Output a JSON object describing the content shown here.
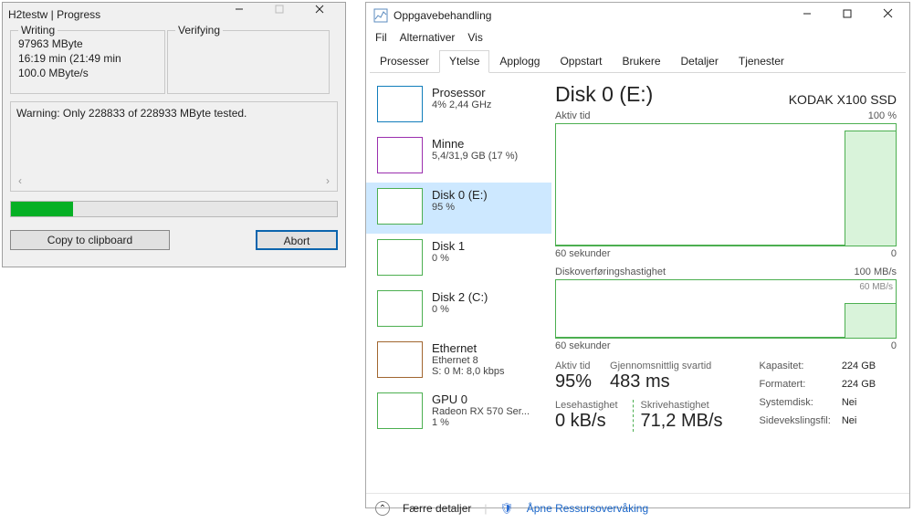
{
  "h2": {
    "title": "H2testw | Progress",
    "writing_legend": "Writing",
    "verifying_legend": "Verifying",
    "writing_l1": "97963 MByte",
    "writing_l2": "16:19 min (21:49 min",
    "writing_l3": "100.0 MByte/s",
    "warning": "Warning: Only 228833 of 228933 MByte tested.",
    "copy_btn": "Copy to clipboard",
    "abort_btn": "Abort",
    "progress_pct": 19
  },
  "tm": {
    "title": "Oppgavebehandling",
    "menu": [
      "Fil",
      "Alternativer",
      "Vis"
    ],
    "tabs": [
      "Prosesser",
      "Ytelse",
      "Applogg",
      "Oppstart",
      "Brukere",
      "Detaljer",
      "Tjenester"
    ],
    "active_tab": 1,
    "sidebar": [
      {
        "title": "Prosessor",
        "sub": "4%  2,44 GHz",
        "kind": "cpu"
      },
      {
        "title": "Minne",
        "sub": "5,4/31,9 GB (17 %)",
        "kind": "mem"
      },
      {
        "title": "Disk 0 (E:)",
        "sub": "95 %",
        "kind": "disk",
        "selected": true
      },
      {
        "title": "Disk 1",
        "sub": "0 %",
        "kind": "disk"
      },
      {
        "title": "Disk 2 (C:)",
        "sub": "0 %",
        "kind": "disk"
      },
      {
        "title": "Ethernet",
        "sub": "Ethernet 8",
        "sub2": "S: 0  M: 8,0 kbps",
        "kind": "eth"
      },
      {
        "title": "GPU 0",
        "sub": "Radeon RX 570 Ser...",
        "sub2": "1 %",
        "kind": "gpu"
      }
    ],
    "main": {
      "heading": "Disk 0 (E:)",
      "model": "KODAK X100 SSD",
      "chart1_tl": "Aktiv tid",
      "chart1_tr": "100 %",
      "chart1_bl": "60 sekunder",
      "chart1_br": "0",
      "chart2_t": "Diskoverføringshastighet",
      "chart2_tr": "100 MB/s",
      "chart2_rlbl": "60 MB/s",
      "chart2_bl": "60 sekunder",
      "chart2_br": "0",
      "s_active_lbl": "Aktiv tid",
      "s_active_val": "95%",
      "s_resp_lbl": "Gjennomsnittlig svartid",
      "s_resp_val": "483 ms",
      "s_read_lbl": "Lesehastighet",
      "s_read_val": "0 kB/s",
      "s_write_lbl": "Skrivehastighet",
      "s_write_val": "71,2 MB/s",
      "cap": {
        "k1": "Kapasitet:",
        "v1": "224 GB",
        "k2": "Formatert:",
        "v2": "224 GB",
        "k3": "Systemdisk:",
        "v3": "Nei",
        "k4": "Sidevekslingsfil:",
        "v4": "Nei"
      }
    },
    "footer": {
      "fewer": "Færre detaljer",
      "resmon": "Åpne Ressursovervåking"
    }
  },
  "chart_data": [
    {
      "type": "line",
      "title": "Aktiv tid",
      "xlabel": "60 sekunder",
      "ylabel": "%",
      "ylim": [
        0,
        100
      ],
      "x_seconds_ago": [
        60,
        55,
        50,
        45,
        40,
        35,
        30,
        25,
        20,
        15,
        10,
        8,
        6,
        4,
        2,
        0
      ],
      "values": [
        0,
        0,
        0,
        0,
        0,
        0,
        0,
        0,
        0,
        0,
        5,
        90,
        96,
        95,
        95,
        95
      ]
    },
    {
      "type": "line",
      "title": "Diskoverføringshastighet",
      "xlabel": "60 sekunder",
      "ylabel": "MB/s",
      "ylim": [
        0,
        100
      ],
      "x_seconds_ago": [
        60,
        55,
        50,
        45,
        40,
        35,
        30,
        25,
        20,
        15,
        10,
        8,
        6,
        4,
        2,
        0
      ],
      "values": [
        0,
        0,
        0,
        0,
        0,
        0,
        0,
        0,
        0,
        0,
        2,
        55,
        62,
        60,
        60,
        60
      ]
    }
  ]
}
